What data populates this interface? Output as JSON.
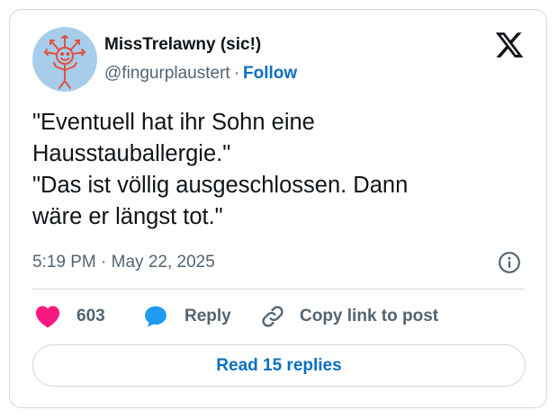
{
  "author": {
    "name": "MissTrelawny (sic!)",
    "handle": "@fingurplaustert",
    "separator": "·",
    "follow_label": "Follow",
    "avatar_icon": "hand-drawn-sun-face-avatar"
  },
  "platform_icon": "x-logo-icon",
  "tweet": {
    "lines": [
      "\"Eventuell hat ihr Sohn eine",
      "Hausstauballergie.\"",
      "\"Das ist völlig ausgeschlossen. Dann",
      "wäre er längst tot.\""
    ],
    "time": "5:19 PM",
    "separator": "·",
    "date": "May 22, 2025"
  },
  "actions": {
    "like_count": "603",
    "reply_label": "Reply",
    "copy_label": "Copy link to post"
  },
  "read_replies_label": "Read 15 replies",
  "colors": {
    "link_blue": "#0a6fc2",
    "heart_pink": "#f91880",
    "reply_blue": "#1d9bf0",
    "muted_text": "#536471",
    "border": "#cfd9de",
    "avatar_bg": "#a7cdea",
    "avatar_drawing": "#e0523f"
  }
}
